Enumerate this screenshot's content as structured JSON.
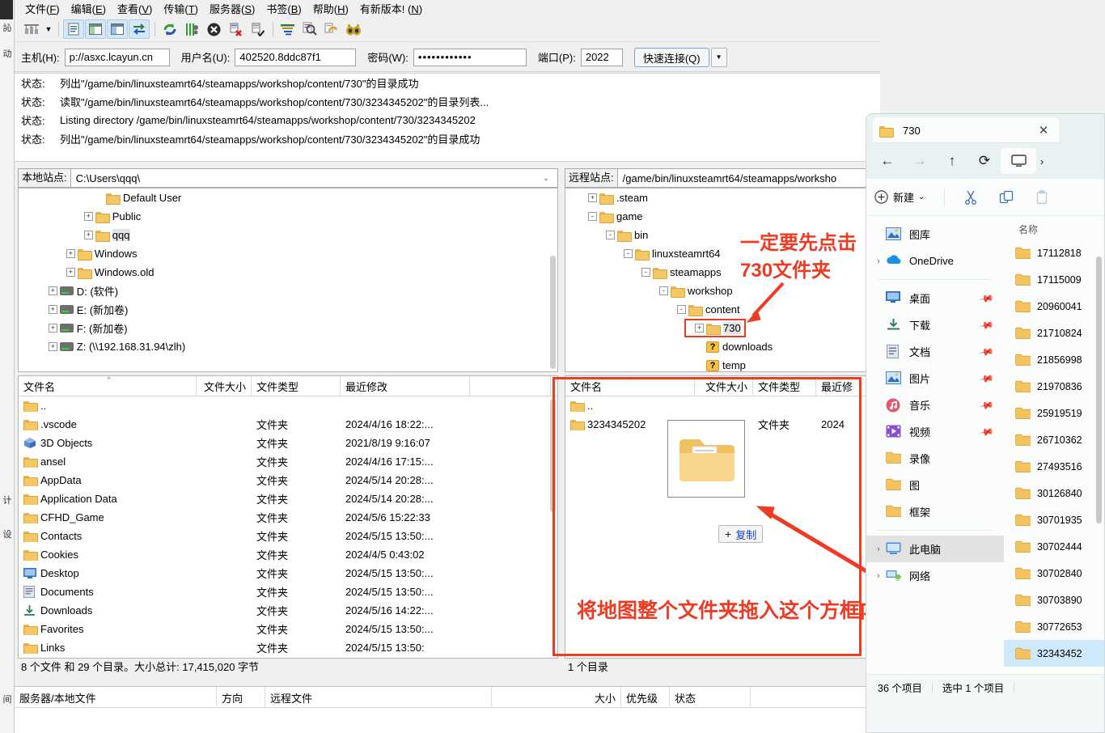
{
  "filezilla": {
    "menu": [
      {
        "label": "文件(F)",
        "key": "F"
      },
      {
        "label": "编辑(E)",
        "key": "E"
      },
      {
        "label": "查看(V)",
        "key": "V"
      },
      {
        "label": "传输(T)",
        "key": "T"
      },
      {
        "label": "服务器(S)",
        "key": "S"
      },
      {
        "label": "书签(B)",
        "key": "B"
      },
      {
        "label": "帮助(H)",
        "key": "H"
      },
      {
        "label": "有新版本! (N)",
        "key": "N"
      }
    ],
    "toolbar_icons": [
      "site-manager-icon",
      "dropdown-caret-icon",
      "toggle-message-log-icon",
      "toggle-local-tree-icon",
      "toggle-remote-tree-icon",
      "toggle-transfer-queue-icon",
      "refresh-icon",
      "process-queue-icon",
      "cancel-icon",
      "disconnect-icon",
      "reconnect-icon",
      "filter-icon",
      "directory-compare-icon",
      "synchronized-browsing-icon",
      "find-files-icon"
    ],
    "quickconnect": {
      "host_label": "主机(H):",
      "host_value": "p://asxc.lcayun.cn",
      "user_label": "用户名(U):",
      "user_value": "402520.8ddc87f1",
      "pass_label": "密码(W):",
      "pass_value": "••••••••••••",
      "port_label": "端口(P):",
      "port_value": "2022",
      "connect_label": "快速连接(Q)"
    },
    "log": [
      {
        "key": "状态:",
        "msg": "列出\"/game/bin/linuxsteamrt64/steamapps/workshop/content/730\"的目录成功"
      },
      {
        "key": "状态:",
        "msg": "读取\"/game/bin/linuxsteamrt64/steamapps/workshop/content/730/3234345202\"的目录列表..."
      },
      {
        "key": "状态:",
        "msg": "Listing directory /game/bin/linuxsteamrt64/steamapps/workshop/content/730/3234345202"
      },
      {
        "key": "状态:",
        "msg": "列出\"/game/bin/linuxsteamrt64/steamapps/workshop/content/730/3234345202\"的目录成功"
      }
    ],
    "local": {
      "site_label": "本地站点:",
      "site_path": "C:\\Users\\qqq\\",
      "tree": [
        {
          "label": "Default User",
          "indent": 4,
          "exp": "",
          "icon": "folder",
          "sel": false
        },
        {
          "label": "Public",
          "indent": 3.4,
          "exp": "+",
          "icon": "folder",
          "sel": false
        },
        {
          "label": "qqq",
          "indent": 3.4,
          "exp": "+",
          "icon": "folder",
          "sel": true
        },
        {
          "label": "Windows",
          "indent": 2.4,
          "exp": "+",
          "icon": "folder",
          "sel": false
        },
        {
          "label": "Windows.old",
          "indent": 2.4,
          "exp": "+",
          "icon": "folder",
          "sel": false
        },
        {
          "label": "D: (软件)",
          "indent": 1.4,
          "exp": "+",
          "icon": "drive",
          "sel": false
        },
        {
          "label": "E: (新加卷)",
          "indent": 1.4,
          "exp": "+",
          "icon": "drive",
          "sel": false
        },
        {
          "label": "F: (新加卷)",
          "indent": 1.4,
          "exp": "+",
          "icon": "drive",
          "sel": false
        },
        {
          "label": "Z: (\\\\192.168.31.94\\zlh)",
          "indent": 1.4,
          "exp": "+",
          "icon": "drive",
          "sel": false
        }
      ],
      "columns": [
        "文件名",
        "文件大小",
        "文件类型",
        "最近修改",
        ""
      ],
      "rows": [
        {
          "name": "..",
          "size": "",
          "type": "",
          "mod": "",
          "icon": "folder"
        },
        {
          "name": ".vscode",
          "size": "",
          "type": "文件夹",
          "mod": "2024/4/16 18:22:...",
          "icon": "folder"
        },
        {
          "name": "3D Objects",
          "size": "",
          "type": "文件夹",
          "mod": "2021/8/19 9:16:07",
          "icon": "3dobjects"
        },
        {
          "name": "ansel",
          "size": "",
          "type": "文件夹",
          "mod": "2024/4/16 17:15:...",
          "icon": "folder"
        },
        {
          "name": "AppData",
          "size": "",
          "type": "文件夹",
          "mod": "2024/5/14 20:28:...",
          "icon": "folder"
        },
        {
          "name": "Application Data",
          "size": "",
          "type": "文件夹",
          "mod": "2024/5/14 20:28:...",
          "icon": "folder"
        },
        {
          "name": "CFHD_Game",
          "size": "",
          "type": "文件夹",
          "mod": "2024/5/6 15:22:33",
          "icon": "folder"
        },
        {
          "name": "Contacts",
          "size": "",
          "type": "文件夹",
          "mod": "2024/5/15 13:50:...",
          "icon": "folder"
        },
        {
          "name": "Cookies",
          "size": "",
          "type": "文件夹",
          "mod": "2024/4/5 0:43:02",
          "icon": "folder"
        },
        {
          "name": "Desktop",
          "size": "",
          "type": "文件夹",
          "mod": "2024/5/15 13:50:...",
          "icon": "desktop"
        },
        {
          "name": "Documents",
          "size": "",
          "type": "文件夹",
          "mod": "2024/5/15 13:50:...",
          "icon": "documents"
        },
        {
          "name": "Downloads",
          "size": "",
          "type": "文件夹",
          "mod": "2024/5/16 14:22:...",
          "icon": "downloads"
        },
        {
          "name": "Favorites",
          "size": "",
          "type": "文件夹",
          "mod": "2024/5/15 13:50:...",
          "icon": "folder"
        },
        {
          "name": "Links",
          "size": "",
          "type": "文件夹",
          "mod": "2024/5/15 13:50:",
          "icon": "folder"
        }
      ],
      "status": "8 个文件 和 29 个目录。大小总计: 17,415,020 字节"
    },
    "remote": {
      "site_label": "远程站点:",
      "site_path": "/game/bin/linuxsteamrt64/steamapps/worksho",
      "tree": [
        {
          "label": ".steam",
          "indent": 1.0,
          "exp": "+",
          "icon": "folder",
          "sel": false
        },
        {
          "label": "game",
          "indent": 1.0,
          "exp": "-",
          "icon": "folder",
          "sel": false
        },
        {
          "label": "bin",
          "indent": 2.0,
          "exp": "-",
          "icon": "folder",
          "sel": false
        },
        {
          "label": "linuxsteamrt64",
          "indent": 3.0,
          "exp": "-",
          "icon": "folder",
          "sel": false
        },
        {
          "label": "steamapps",
          "indent": 4.0,
          "exp": "-",
          "icon": "folder",
          "sel": false
        },
        {
          "label": "workshop",
          "indent": 5.0,
          "exp": "-",
          "icon": "folder",
          "sel": false
        },
        {
          "label": "content",
          "indent": 6.0,
          "exp": "-",
          "icon": "folder",
          "sel": false
        },
        {
          "label": "730",
          "indent": 7.0,
          "exp": "+",
          "icon": "folder",
          "sel": true
        },
        {
          "label": "downloads",
          "indent": 7.0,
          "exp": "",
          "icon": "question",
          "sel": false
        },
        {
          "label": "temp",
          "indent": 7.0,
          "exp": "",
          "icon": "question",
          "sel": false
        }
      ],
      "columns": [
        "文件名",
        "文件大小",
        "文件类型",
        "最近修"
      ],
      "rows": [
        {
          "name": "..",
          "size": "",
          "type": "",
          "mod": "",
          "icon": "folder"
        },
        {
          "name": "3234345202",
          "size": "",
          "type": "文件夹",
          "mod": "2024",
          "icon": "folder"
        }
      ],
      "status": "1 个目录"
    },
    "queue_columns": [
      "服务器/本地文件",
      "方向",
      "远程文件",
      "大小",
      "优先级",
      "状态"
    ],
    "drag": {
      "badge_plus": "+",
      "badge_label": "复制"
    }
  },
  "annotations": {
    "note_click_730_line1": "一定要先点击",
    "note_click_730_line2": "730文件夹",
    "note_drag": "将地图整个文件夹拖入这个方框内",
    "color": "#ee3b24"
  },
  "explorer": {
    "tab_title": "730",
    "close_label": "✕",
    "nav_icons": [
      "back-arrow-icon",
      "forward-arrow-icon",
      "up-arrow-icon",
      "refresh-icon",
      "this-pc-icon",
      "chevron-right-icon"
    ],
    "cmdbar": {
      "new_label": "新建",
      "new_caret": "⌄",
      "icons": [
        "cut-icon",
        "copy-icon",
        "paste-icon"
      ]
    },
    "nav_items": [
      {
        "label": "图库",
        "icon": "gallery-icon",
        "chev": false,
        "pin": false,
        "sel": false
      },
      {
        "label": "OneDrive",
        "icon": "onedrive-icon",
        "chev": true,
        "pin": false,
        "sel": false
      },
      {
        "divider": true
      },
      {
        "label": "桌面",
        "icon": "desktop-icon",
        "chev": false,
        "pin": true,
        "sel": false
      },
      {
        "label": "下载",
        "icon": "downloads-icon",
        "chev": false,
        "pin": true,
        "sel": false
      },
      {
        "label": "文档",
        "icon": "documents-icon",
        "chev": false,
        "pin": true,
        "sel": false
      },
      {
        "label": "图片",
        "icon": "pictures-icon",
        "chev": false,
        "pin": true,
        "sel": false
      },
      {
        "label": "音乐",
        "icon": "music-icon",
        "chev": false,
        "pin": true,
        "sel": false
      },
      {
        "label": "视频",
        "icon": "videos-icon",
        "chev": false,
        "pin": true,
        "sel": false
      },
      {
        "label": "录像",
        "icon": "folder-icon",
        "chev": false,
        "pin": false,
        "sel": false
      },
      {
        "label": "图",
        "icon": "folder-icon",
        "chev": false,
        "pin": false,
        "sel": false
      },
      {
        "label": "框架",
        "icon": "folder-icon",
        "chev": false,
        "pin": false,
        "sel": false
      },
      {
        "divider": true
      },
      {
        "label": "此电脑",
        "icon": "this-pc-icon",
        "chev": true,
        "pin": false,
        "sel": true
      },
      {
        "label": "网络",
        "icon": "network-icon",
        "chev": true,
        "pin": false,
        "sel": false
      }
    ],
    "column_name": "名称",
    "files": [
      {
        "name": "17112818",
        "sel": false
      },
      {
        "name": "17115009",
        "sel": false
      },
      {
        "name": "20960041",
        "sel": false
      },
      {
        "name": "21710824",
        "sel": false
      },
      {
        "name": "21856998",
        "sel": false
      },
      {
        "name": "21970836",
        "sel": false
      },
      {
        "name": "25919519",
        "sel": false
      },
      {
        "name": "26710362",
        "sel": false
      },
      {
        "name": "27493516",
        "sel": false
      },
      {
        "name": "30126840",
        "sel": false
      },
      {
        "name": "30701935",
        "sel": false
      },
      {
        "name": "30702444",
        "sel": false
      },
      {
        "name": "30702840",
        "sel": false
      },
      {
        "name": "30703890",
        "sel": false
      },
      {
        "name": "30772653",
        "sel": false
      },
      {
        "name": "32343452",
        "sel": true
      }
    ],
    "status_count": "36 个项目",
    "status_selected": "选中 1 个项目"
  }
}
